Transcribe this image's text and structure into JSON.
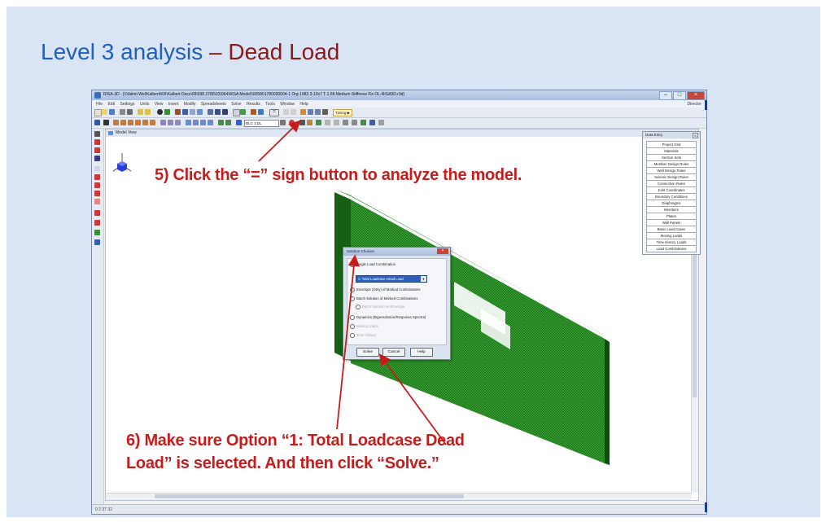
{
  "slide": {
    "title_part1": "Level 3 analysis",
    "title_dash": " – ",
    "title_part2": "Dead Load"
  },
  "app": {
    "window_title": "RISA-3D - [\\\\Valiml-Wel\\Kalbert\\KR\\Kalbert Docs\\09\\098 2780\\03\\064\\RISA Model\\\\005801780030004-1 Org 1983 3-10x7 T-1.5ft Medium Stiffness Fix OL-RISA3D.r3d]",
    "menu": [
      "File",
      "Edit",
      "Settings",
      "Units",
      "View",
      "Insert",
      "Modify",
      "Spreadsheets",
      "Solve",
      "Results",
      "Tools",
      "Window",
      "Help"
    ],
    "menu_right": "Director",
    "lc_select": "BLC 1:DL",
    "timing_label": "Timing ▶",
    "model_view_title": "Model View",
    "status_text": "0 2 37 32"
  },
  "data_entry": {
    "title": "Data Entry",
    "items": [
      "Project Grid",
      "Materials",
      "Section Sets",
      "Member Design Rules",
      "Wall Design Rules",
      "Seismic Design Rules",
      "Connection Rules",
      "Joint Coordinates",
      "Boundary Conditions",
      "Diaphragms",
      "Members",
      "Plates",
      "Wall Panels",
      "Basic Load Cases",
      "Moving Loads",
      "Time History Loads",
      "Load Combinations"
    ]
  },
  "dialog": {
    "title": "Solution Choices",
    "opt_single": "Single Load Combination",
    "combo_value": "1: Total Loadcase Dead Load",
    "opt_envelope": "Envelope (Only) of Marked Combinations",
    "opt_batch": "Batch Solution of Marked Combinations",
    "opt_batch_sub": "Batch Solution w/ Envelope",
    "opt_dynamics": "Dynamics (Eigensolution/Response Spectra)",
    "opt_moving": "Moving Loads",
    "opt_time": "Time History",
    "btn_solve": "Solve",
    "btn_cancel": "Cancel",
    "btn_help": "Help"
  },
  "annotations": {
    "step5": "5) Click the “=” sign button to analyze the model.",
    "step6_line1": "6) Make sure Option “1: Total Loadcase Dead",
    "step6_line2": "Load” is selected. And then click “Solve.”"
  },
  "colors": {
    "title_blue": "#1f5fbf",
    "title_red": "#8b1a1a",
    "annotation_red": "#c81c1c",
    "model_green": "#1f7a1f",
    "slide_bg": "#d9e4f5"
  }
}
